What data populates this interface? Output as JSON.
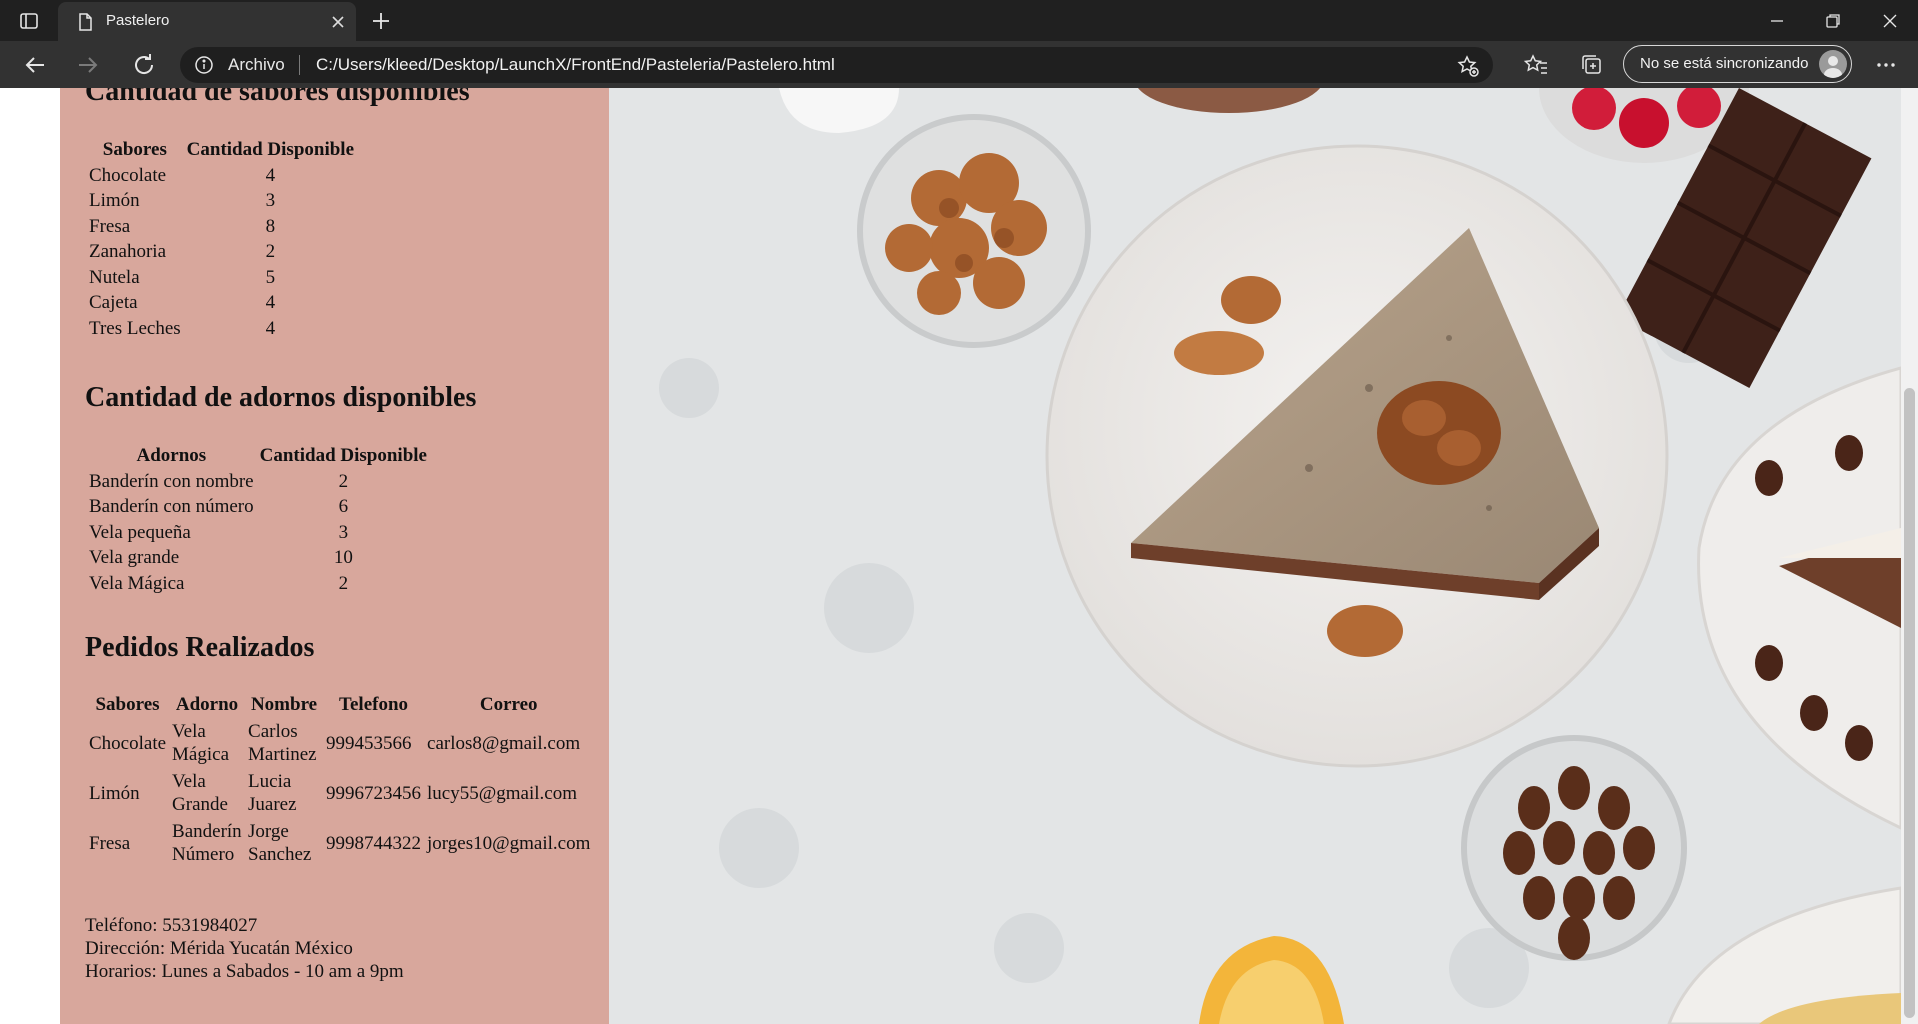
{
  "browser": {
    "tab_title": "Pastelero",
    "address_scheme": "Archivo",
    "address_url": "C:/Users/kleed/Desktop/LaunchX/FrontEnd/Pasteleria/Pastelero.html",
    "sync_label": "No se está sincronizando"
  },
  "flavors": {
    "title": "Cantidad de sabores disponibles",
    "headers": [
      "Sabores",
      "Cantidad Disponible"
    ],
    "rows": [
      [
        "Chocolate",
        "4"
      ],
      [
        "Limón",
        "3"
      ],
      [
        "Fresa",
        "8"
      ],
      [
        "Zanahoria",
        "2"
      ],
      [
        "Nutela",
        "5"
      ],
      [
        "Cajeta",
        "4"
      ],
      [
        "Tres Leches",
        "4"
      ]
    ]
  },
  "decorations": {
    "title": "Cantidad de adornos disponibles",
    "headers": [
      "Adornos",
      "Cantidad Disponible"
    ],
    "rows": [
      [
        "Banderín con nombre",
        "2"
      ],
      [
        "Banderín con número",
        "6"
      ],
      [
        "Vela pequeña",
        "3"
      ],
      [
        "Vela grande",
        "10"
      ],
      [
        "Vela Mágica",
        "2"
      ]
    ]
  },
  "orders": {
    "title": "Pedidos Realizados",
    "headers": [
      "Sabores",
      "Adorno",
      "Nombre",
      "Telefono",
      "Correo"
    ],
    "rows": [
      [
        "Chocolate",
        "Vela Mágica",
        "Carlos Martinez",
        "999453566",
        "carlos8@gmail.com"
      ],
      [
        "Limón",
        "Vela Grande",
        "Lucia Juarez",
        "9996723456",
        "lucy55@gmail.com"
      ],
      [
        "Fresa",
        "Banderín Número",
        "Jorge Sanchez",
        "9998744322",
        "jorges10@gmail.com"
      ]
    ]
  },
  "contact": {
    "phone": "Teléfono: 5531984027",
    "address": "Dirección: Mérida Yucatán México",
    "hours": "Horarios: Lunes a Sabados - 10 am a 9pm"
  },
  "colors": {
    "sidebar_bg": "#d8a79c",
    "chrome_dark": "#202020",
    "toolbar": "#323232"
  }
}
